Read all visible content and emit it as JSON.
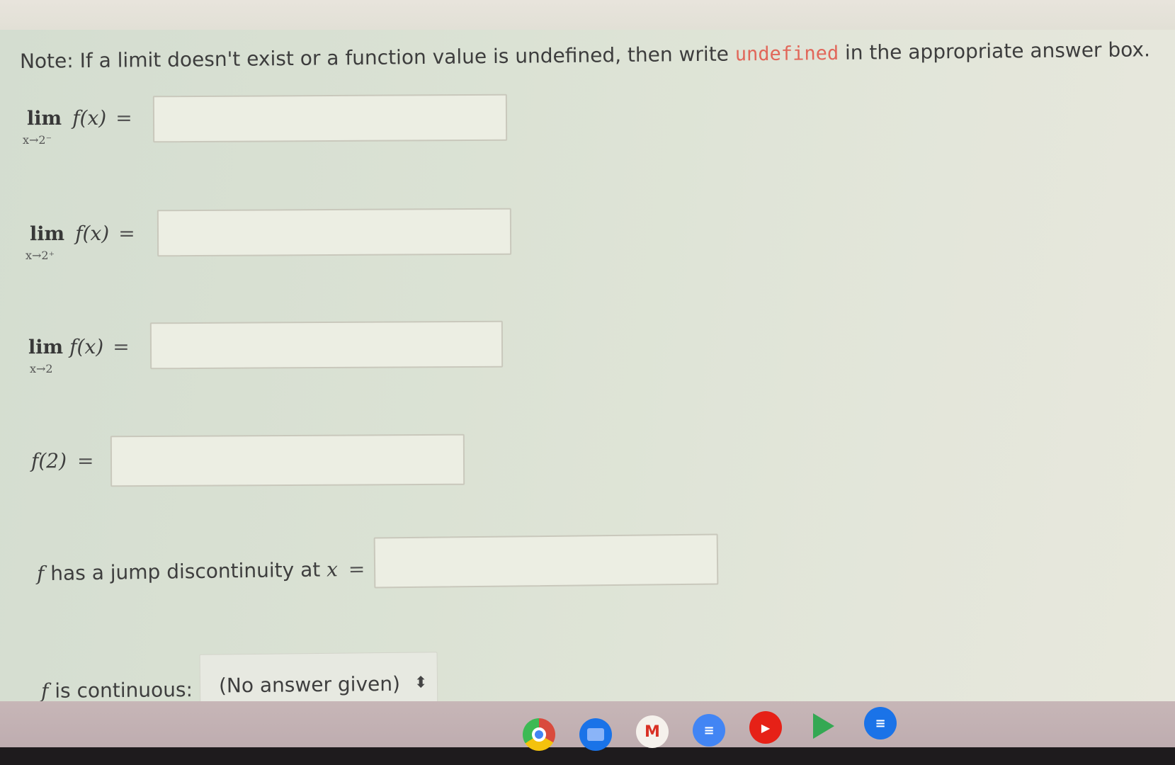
{
  "note": {
    "prefix": "Note: If a limit doesn't exist or a function value is undefined, then write ",
    "keyword": "undefined",
    "suffix": " in the appropriate answer box."
  },
  "rows": [
    {
      "lim": "lim",
      "sub": "x→2⁻",
      "fx": "f(x)",
      "eq": "=",
      "value": ""
    },
    {
      "lim": "lim",
      "sub": "x→2⁺",
      "fx": "f(x)",
      "eq": "=",
      "value": ""
    },
    {
      "lim": "lim",
      "sub": "x→2",
      "fx": "f(x)",
      "eq": "=",
      "value": ""
    }
  ],
  "f2": {
    "label": "f(2)",
    "eq": "=",
    "value": ""
  },
  "jump": {
    "f": "f",
    "text": " has a jump discontinuity at ",
    "x": "x",
    "eq": "=",
    "value": ""
  },
  "continuous": {
    "f": "f",
    "text": " is continuous:",
    "selected": "(No answer given)"
  },
  "shelf_apps": [
    {
      "name": "chrome",
      "color": "#d94b3d"
    },
    {
      "name": "files",
      "color": "#1a73e8"
    },
    {
      "name": "gmail",
      "color": "#ffffff",
      "letter": "M"
    },
    {
      "name": "docs",
      "color": "#4285f4"
    },
    {
      "name": "youtube",
      "color": "#e62117"
    },
    {
      "name": "play-store",
      "color": "#34a853"
    },
    {
      "name": "messages",
      "color": "#1a73e8"
    }
  ]
}
